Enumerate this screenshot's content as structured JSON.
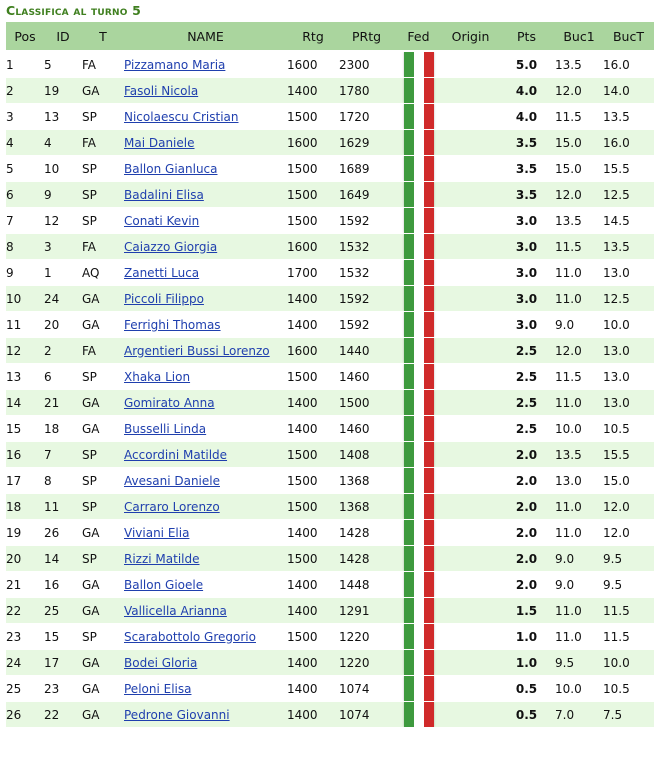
{
  "title": "Classifica al turno 5",
  "columns": [
    "Pos",
    "ID",
    "T",
    "NAME",
    "Rtg",
    "PRtg",
    "Fed",
    "Origin",
    "Pts",
    "Buc1",
    "BucT"
  ],
  "flag_icon": "italy-flag-icon",
  "colors": {
    "header_bg": "#aad59e",
    "stripe_bg": "#e7f8e1",
    "title": "#3f7f1f",
    "link": "#1f3fae",
    "flag_green": "#3e9a3e",
    "flag_white": "#ffffff",
    "flag_red": "#d02a2a"
  },
  "rows": [
    {
      "pos": "1",
      "id": "5",
      "t": "FA",
      "name": "Pizzamano Maria",
      "rtg": "1600",
      "prtg": "2300",
      "origin": "",
      "pts": "5.0",
      "buc1": "13.5",
      "buct": "16.0"
    },
    {
      "pos": "2",
      "id": "19",
      "t": "GA",
      "name": "Fasoli Nicola",
      "rtg": "1400",
      "prtg": "1780",
      "origin": "",
      "pts": "4.0",
      "buc1": "12.0",
      "buct": "14.0"
    },
    {
      "pos": "3",
      "id": "13",
      "t": "SP",
      "name": "Nicolaescu Cristian",
      "rtg": "1500",
      "prtg": "1720",
      "origin": "",
      "pts": "4.0",
      "buc1": "11.5",
      "buct": "13.5"
    },
    {
      "pos": "4",
      "id": "4",
      "t": "FA",
      "name": "Mai Daniele",
      "rtg": "1600",
      "prtg": "1629",
      "origin": "",
      "pts": "3.5",
      "buc1": "15.0",
      "buct": "16.0"
    },
    {
      "pos": "5",
      "id": "10",
      "t": "SP",
      "name": "Ballon Gianluca",
      "rtg": "1500",
      "prtg": "1689",
      "origin": "",
      "pts": "3.5",
      "buc1": "15.0",
      "buct": "15.5"
    },
    {
      "pos": "6",
      "id": "9",
      "t": "SP",
      "name": "Badalini Elisa",
      "rtg": "1500",
      "prtg": "1649",
      "origin": "",
      "pts": "3.5",
      "buc1": "12.0",
      "buct": "12.5"
    },
    {
      "pos": "7",
      "id": "12",
      "t": "SP",
      "name": "Conati Kevin",
      "rtg": "1500",
      "prtg": "1592",
      "origin": "",
      "pts": "3.0",
      "buc1": "13.5",
      "buct": "14.5"
    },
    {
      "pos": "8",
      "id": "3",
      "t": "FA",
      "name": "Caiazzo Giorgia",
      "rtg": "1600",
      "prtg": "1532",
      "origin": "",
      "pts": "3.0",
      "buc1": "11.5",
      "buct": "13.5"
    },
    {
      "pos": "9",
      "id": "1",
      "t": "AQ",
      "name": "Zanetti Luca",
      "rtg": "1700",
      "prtg": "1532",
      "origin": "",
      "pts": "3.0",
      "buc1": "11.0",
      "buct": "13.0"
    },
    {
      "pos": "10",
      "id": "24",
      "t": "GA",
      "name": "Piccoli Filippo",
      "rtg": "1400",
      "prtg": "1592",
      "origin": "",
      "pts": "3.0",
      "buc1": "11.0",
      "buct": "12.5"
    },
    {
      "pos": "11",
      "id": "20",
      "t": "GA",
      "name": "Ferrighi Thomas",
      "rtg": "1400",
      "prtg": "1592",
      "origin": "",
      "pts": "3.0",
      "buc1": "9.0",
      "buct": "10.0"
    },
    {
      "pos": "12",
      "id": "2",
      "t": "FA",
      "name": "Argentieri Bussi Lorenzo",
      "rtg": "1600",
      "prtg": "1440",
      "origin": "",
      "pts": "2.5",
      "buc1": "12.0",
      "buct": "13.0"
    },
    {
      "pos": "13",
      "id": "6",
      "t": "SP",
      "name": "Xhaka Lion",
      "rtg": "1500",
      "prtg": "1460",
      "origin": "",
      "pts": "2.5",
      "buc1": "11.5",
      "buct": "13.0"
    },
    {
      "pos": "14",
      "id": "21",
      "t": "GA",
      "name": "Gomirato Anna",
      "rtg": "1400",
      "prtg": "1500",
      "origin": "",
      "pts": "2.5",
      "buc1": "11.0",
      "buct": "13.0"
    },
    {
      "pos": "15",
      "id": "18",
      "t": "GA",
      "name": "Busselli Linda",
      "rtg": "1400",
      "prtg": "1460",
      "origin": "",
      "pts": "2.5",
      "buc1": "10.0",
      "buct": "10.5"
    },
    {
      "pos": "16",
      "id": "7",
      "t": "SP",
      "name": "Accordini Matilde",
      "rtg": "1500",
      "prtg": "1408",
      "origin": "",
      "pts": "2.0",
      "buc1": "13.5",
      "buct": "15.5"
    },
    {
      "pos": "17",
      "id": "8",
      "t": "SP",
      "name": "Avesani Daniele",
      "rtg": "1500",
      "prtg": "1368",
      "origin": "",
      "pts": "2.0",
      "buc1": "13.0",
      "buct": "15.0"
    },
    {
      "pos": "18",
      "id": "11",
      "t": "SP",
      "name": "Carraro Lorenzo",
      "rtg": "1500",
      "prtg": "1368",
      "origin": "",
      "pts": "2.0",
      "buc1": "11.0",
      "buct": "12.0"
    },
    {
      "pos": "19",
      "id": "26",
      "t": "GA",
      "name": "Viviani Elia",
      "rtg": "1400",
      "prtg": "1428",
      "origin": "",
      "pts": "2.0",
      "buc1": "11.0",
      "buct": "12.0"
    },
    {
      "pos": "20",
      "id": "14",
      "t": "SP",
      "name": "Rizzi Matilde",
      "rtg": "1500",
      "prtg": "1428",
      "origin": "",
      "pts": "2.0",
      "buc1": "9.0",
      "buct": "9.5"
    },
    {
      "pos": "21",
      "id": "16",
      "t": "GA",
      "name": "Ballon Gioele",
      "rtg": "1400",
      "prtg": "1448",
      "origin": "",
      "pts": "2.0",
      "buc1": "9.0",
      "buct": "9.5"
    },
    {
      "pos": "22",
      "id": "25",
      "t": "GA",
      "name": "Vallicella Arianna",
      "rtg": "1400",
      "prtg": "1291",
      "origin": "",
      "pts": "1.5",
      "buc1": "11.0",
      "buct": "11.5"
    },
    {
      "pos": "23",
      "id": "15",
      "t": "SP",
      "name": "Scarabottolo Gregorio",
      "rtg": "1500",
      "prtg": "1220",
      "origin": "",
      "pts": "1.0",
      "buc1": "11.0",
      "buct": "11.5"
    },
    {
      "pos": "24",
      "id": "17",
      "t": "GA",
      "name": "Bodei Gloria",
      "rtg": "1400",
      "prtg": "1220",
      "origin": "",
      "pts": "1.0",
      "buc1": "9.5",
      "buct": "10.0"
    },
    {
      "pos": "25",
      "id": "23",
      "t": "GA",
      "name": "Peloni Elisa",
      "rtg": "1400",
      "prtg": "1074",
      "origin": "",
      "pts": "0.5",
      "buc1": "10.0",
      "buct": "10.5"
    },
    {
      "pos": "26",
      "id": "22",
      "t": "GA",
      "name": "Pedrone Giovanni",
      "rtg": "1400",
      "prtg": "1074",
      "origin": "",
      "pts": "0.5",
      "buc1": "7.0",
      "buct": "7.5"
    }
  ]
}
